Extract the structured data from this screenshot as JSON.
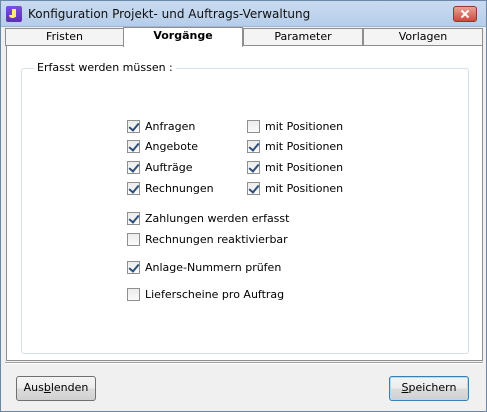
{
  "window": {
    "title": "Konfiguration Projekt- und Auftrags-Verwaltung"
  },
  "tabs": [
    {
      "label": "Fristen",
      "active": false
    },
    {
      "label": "Vorgänge",
      "active": true
    },
    {
      "label": "Parameter",
      "active": false
    },
    {
      "label": "Vorlagen",
      "active": false
    }
  ],
  "group": {
    "label": "Erfasst werden müssen :"
  },
  "documents": [
    {
      "label": "Anfragen",
      "checked": true,
      "positions_label": "mit Positionen",
      "positions_checked": false
    },
    {
      "label": "Angebote",
      "checked": true,
      "positions_label": "mit Positionen",
      "positions_checked": true
    },
    {
      "label": "Aufträge",
      "checked": true,
      "positions_label": "mit Positionen",
      "positions_checked": true
    },
    {
      "label": "Rechnungen",
      "checked": true,
      "positions_label": "mit Positionen",
      "positions_checked": true
    }
  ],
  "options": {
    "payments": {
      "label": "Zahlungen werden erfasst",
      "checked": true
    },
    "reactivate": {
      "label": "Rechnungen reaktivierbar",
      "checked": false
    },
    "asset_check": {
      "label": "Anlage-Nummern prüfen",
      "checked": true
    },
    "delivery_notes": {
      "label": "Lieferscheine pro Auftrag",
      "checked": false
    }
  },
  "buttons": {
    "hide": {
      "pre": "Aus",
      "accel": "b",
      "post": "lenden"
    },
    "save": {
      "pre": "",
      "accel": "S",
      "post": "peichern"
    }
  }
}
